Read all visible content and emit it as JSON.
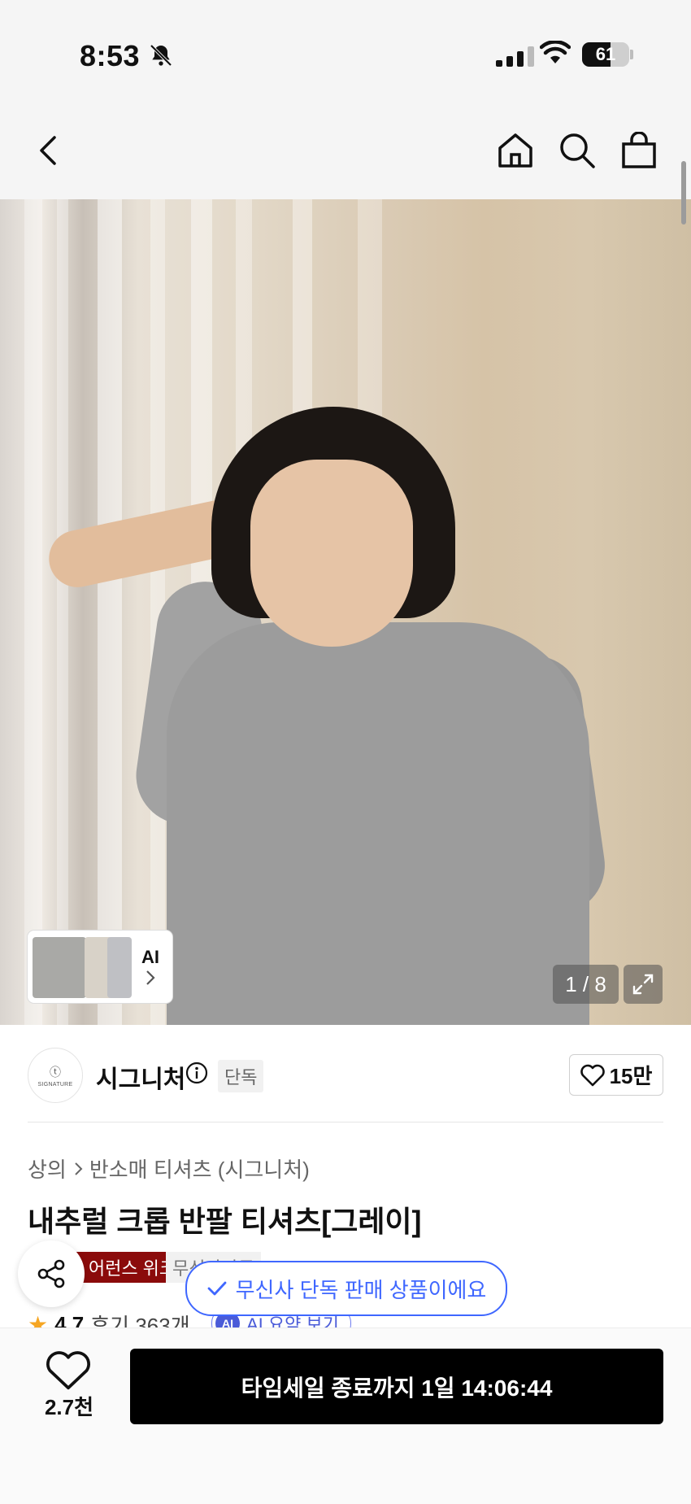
{
  "status_bar": {
    "time": "8:53",
    "battery": "61",
    "battery_level": 0.61
  },
  "nav": {
    "back_icon": "chevron-left-icon",
    "home_icon": "home-icon",
    "search_icon": "search-icon",
    "cart_icon": "shopping-bag-icon"
  },
  "gallery": {
    "ai_label": "AI",
    "counter": "1 / 8"
  },
  "brand": {
    "logo_text": "SIGNATURE",
    "name": "시그니처",
    "exclusive_tag": "단독",
    "likes": "15만"
  },
  "breadcrumb": {
    "level1": "상의",
    "level2": "반소매 티셔츠 (시그니처)"
  },
  "product": {
    "title": "내추럴 크롭 반팔 티셔츠[그레이]"
  },
  "badges": {
    "red": "브랜드 어런스 위크",
    "grey": "무신사단독"
  },
  "rating": {
    "score": "4.7",
    "reviews": "후기 363개",
    "ai_summary": "AI 요약 보기",
    "ai_badge": "AI"
  },
  "toast": {
    "text": "무신사 단독 판매 상품이에요"
  },
  "bottom": {
    "wish_count": "2.7천",
    "cta": "타임세일 종료까지 1일 14:06:44"
  },
  "colors": {
    "accent_blue": "#3f67ff",
    "badge_red": "#8b0b0b",
    "cta_black": "#000000"
  }
}
